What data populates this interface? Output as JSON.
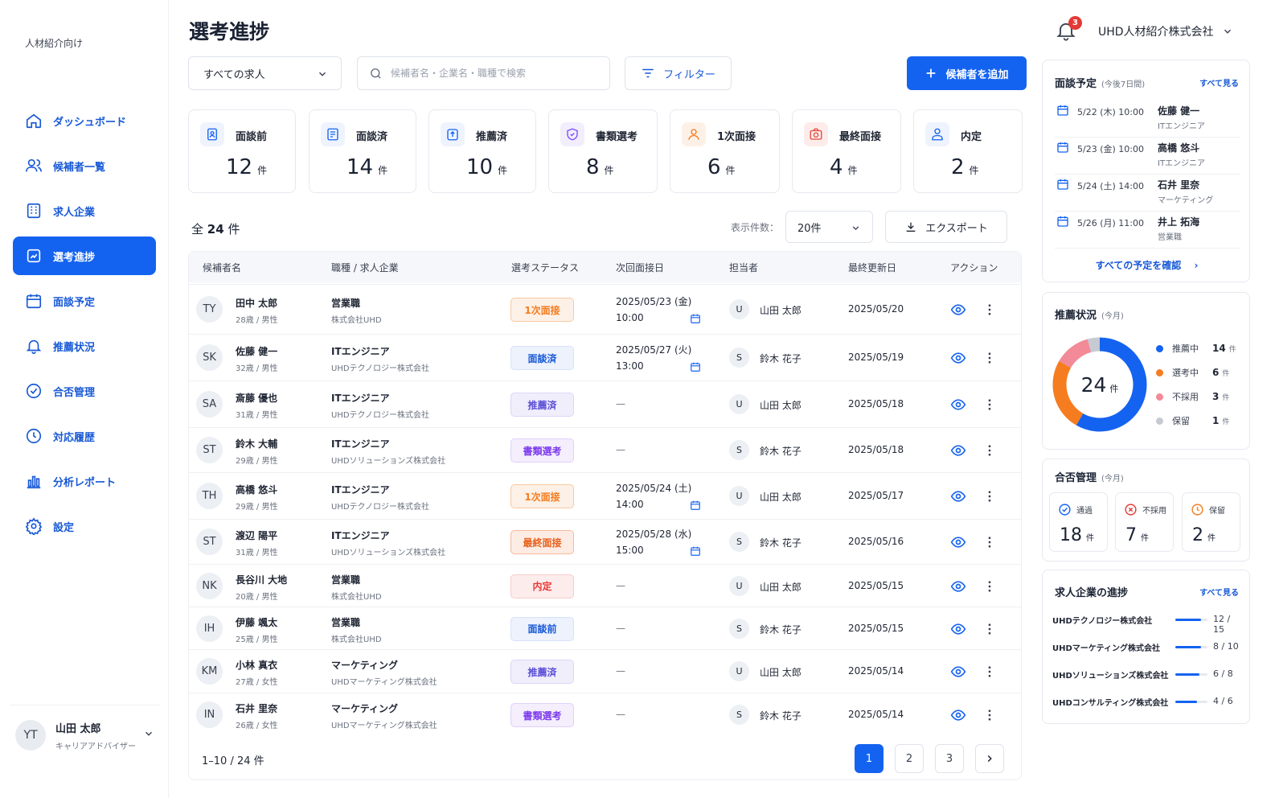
{
  "sidebar": {
    "brand": "人材紹介向け",
    "items": [
      {
        "label": "ダッシュボード",
        "icon": "home-icon"
      },
      {
        "label": "候補者一覧",
        "icon": "users-icon"
      },
      {
        "label": "求人企業",
        "icon": "building-icon"
      },
      {
        "label": "選考進捗",
        "icon": "progress-icon",
        "active": true
      },
      {
        "label": "面談予定",
        "icon": "calendar-icon"
      },
      {
        "label": "推薦状況",
        "icon": "bell-icon"
      },
      {
        "label": "合否管理",
        "icon": "check-circle-icon"
      },
      {
        "label": "対応履歴",
        "icon": "clock-icon"
      },
      {
        "label": "分析レポート",
        "icon": "bar-chart-icon"
      },
      {
        "label": "設定",
        "icon": "gear-icon"
      }
    ],
    "user": {
      "initials": "YT",
      "name": "山田 太郎",
      "role": "キャリアアドバイザー"
    }
  },
  "header": {
    "title": "選考進捗",
    "notification_count": "3",
    "company": "UHD人材紹介株式会社"
  },
  "toolbar": {
    "job_filter": "すべての求人",
    "search_placeholder": "候補者名・企業名・職種で検索",
    "filter_label": "フィルター",
    "add_label": "候補者を追加"
  },
  "stats": [
    {
      "label": "面談前",
      "value": "12",
      "unit": "件",
      "color": "#1463f0",
      "bg": "#eef3fd"
    },
    {
      "label": "面談済",
      "value": "14",
      "unit": "件",
      "color": "#1463f0",
      "bg": "#eef3fd"
    },
    {
      "label": "推薦済",
      "value": "10",
      "unit": "件",
      "color": "#1463f0",
      "bg": "#eef3fd"
    },
    {
      "label": "書類選考",
      "value": "8",
      "unit": "件",
      "color": "#7c4dff",
      "bg": "#f2eefd"
    },
    {
      "label": "1次面接",
      "value": "6",
      "unit": "件",
      "color": "#f57c1f",
      "bg": "#fdf1e7"
    },
    {
      "label": "最終面接",
      "value": "4",
      "unit": "件",
      "color": "#e5483d",
      "bg": "#fdecea"
    },
    {
      "label": "内定",
      "value": "2",
      "unit": "件",
      "color": "#1463f0",
      "bg": "#eef3fd"
    }
  ],
  "list": {
    "total_prefix": "全",
    "total": "24",
    "total_unit": "件",
    "per_page_label": "表示件数：",
    "per_page": "20件",
    "export_label": "エクスポート"
  },
  "table": {
    "columns": [
      "候補者名",
      "職種 / 求人企業",
      "選考ステータス",
      "次回面接日",
      "担当者",
      "最終更新日",
      "アクション"
    ],
    "rows": [
      {
        "initials": "TY",
        "name": "田中 太郎",
        "meta": "28歳 / 男性",
        "job": "営業職",
        "company": "株式会社UHD",
        "status": "1次面接",
        "status_type": "orange",
        "date": "2025/05/23 (金)",
        "time": "10:00",
        "staff_initial": "U",
        "staff": "山田 太郎",
        "updated": "2025/05/20"
      },
      {
        "initials": "SK",
        "name": "佐藤 健一",
        "meta": "32歳 / 男性",
        "job": "ITエンジニア",
        "company": "UHDテクノロジー株式会社",
        "status": "面談済",
        "status_type": "blue",
        "date": "2025/05/27 (火)",
        "time": "13:00",
        "staff_initial": "S",
        "staff": "鈴木 花子",
        "updated": "2025/05/19"
      },
      {
        "initials": "SA",
        "name": "斎藤 優也",
        "meta": "31歳 / 男性",
        "job": "ITエンジニア",
        "company": "UHDテクノロジー株式会社",
        "status": "推薦済",
        "status_type": "purple",
        "date": "",
        "time": "",
        "dash": "—",
        "staff_initial": "U",
        "staff": "山田 太郎",
        "updated": "2025/05/18"
      },
      {
        "initials": "ST",
        "name": "鈴木 大輔",
        "meta": "29歳 / 男性",
        "job": "ITエンジニア",
        "company": "UHDソリューションズ株式会社",
        "status": "書類選考",
        "status_type": "violet",
        "date": "",
        "time": "",
        "dash": "—",
        "staff_initial": "S",
        "staff": "鈴木 花子",
        "updated": "2025/05/18"
      },
      {
        "initials": "TH",
        "name": "高橋 悠斗",
        "meta": "29歳 / 男性",
        "job": "ITエンジニア",
        "company": "UHDテクノロジー株式会社",
        "status": "1次面接",
        "status_type": "orange",
        "date": "2025/05/24 (土)",
        "time": "14:00",
        "staff_initial": "U",
        "staff": "山田 太郎",
        "updated": "2025/05/17"
      },
      {
        "initials": "ST",
        "name": "渡辺 陽平",
        "meta": "31歳 / 男性",
        "job": "ITエンジニア",
        "company": "UHDソリューションズ株式会社",
        "status": "最終面接",
        "status_type": "orange2",
        "date": "2025/05/28 (水)",
        "time": "15:00",
        "staff_initial": "S",
        "staff": "鈴木 花子",
        "updated": "2025/05/16"
      },
      {
        "initials": "NK",
        "name": "長谷川 大地",
        "meta": "20歳 / 男性",
        "job": "営業職",
        "company": "株式会社UHD",
        "status": "内定",
        "status_type": "red",
        "date": "",
        "time": "",
        "dash": "—",
        "staff_initial": "U",
        "staff": "山田 太郎",
        "updated": "2025/05/15"
      },
      {
        "initials": "IH",
        "name": "伊藤 颯太",
        "meta": "25歳 / 男性",
        "job": "営業職",
        "company": "株式会社UHD",
        "status": "面談前",
        "status_type": "blue",
        "date": "",
        "time": "",
        "dash": "—",
        "staff_initial": "S",
        "staff": "鈴木 花子",
        "updated": "2025/05/15"
      },
      {
        "initials": "KM",
        "name": "小林 真衣",
        "meta": "27歳 / 女性",
        "job": "マーケティング",
        "company": "UHDマーケティング株式会社",
        "status": "推薦済",
        "status_type": "purple",
        "date": "",
        "time": "",
        "dash": "—",
        "staff_initial": "U",
        "staff": "山田 太郎",
        "updated": "2025/05/14"
      },
      {
        "initials": "IN",
        "name": "石井 里奈",
        "meta": "26歳 / 女性",
        "job": "マーケティング",
        "company": "UHDマーケティング株式会社",
        "status": "書類選考",
        "status_type": "violet",
        "date": "",
        "time": "",
        "dash": "—",
        "staff_initial": "S",
        "staff": "鈴木 花子",
        "updated": "2025/05/14"
      }
    ]
  },
  "pagination": {
    "info": "1–10 / 24 件",
    "pages": [
      "1",
      "2",
      "3"
    ],
    "next": "›"
  },
  "interviews": {
    "title": "面談予定",
    "subtitle": "(今後7日間)",
    "see_all": "すべて見る",
    "items": [
      {
        "when": "5/22 (木) 10:00",
        "name": "佐藤 健一",
        "position": "ITエンジニア"
      },
      {
        "when": "5/23 (金) 10:00",
        "name": "高橋 悠斗",
        "position": "ITエンジニア"
      },
      {
        "when": "5/24 (土) 14:00",
        "name": "石井 里奈",
        "position": "マーケティング"
      },
      {
        "when": "5/26 (月) 11:00",
        "name": "井上 拓海",
        "position": "営業職"
      }
    ],
    "confirm_label": "すべての予定を確認"
  },
  "recommend": {
    "title": "推薦状況",
    "subtitle": "(今月)",
    "total": "24",
    "total_unit": "件",
    "legend": [
      {
        "label": "推薦中",
        "value": 14,
        "unit": "件",
        "color": "#1463f0"
      },
      {
        "label": "選考中",
        "value": 6,
        "unit": "件",
        "color": "#f57c1f"
      },
      {
        "label": "不採用",
        "value": 3,
        "unit": "件",
        "color": "#f28b97"
      },
      {
        "label": "保留",
        "value": 1,
        "unit": "件",
        "color": "#c5cad3"
      }
    ]
  },
  "passfail": {
    "title": "合否管理",
    "subtitle": "(今月)",
    "items": [
      {
        "label": "通過",
        "value": "18",
        "unit": "件",
        "color": "#1463f0",
        "icon": "check-circle-icon"
      },
      {
        "label": "不採用",
        "value": "7",
        "unit": "件",
        "color": "#e53935",
        "icon": "x-circle-icon"
      },
      {
        "label": "保留",
        "value": "2",
        "unit": "件",
        "color": "#f57c1f",
        "icon": "clock-icon"
      }
    ]
  },
  "company_progress": {
    "title": "求人企業の進捗",
    "see_all": "すべて見る",
    "items": [
      {
        "name": "UHDテクノロジー株式会社",
        "done": 12,
        "total": 15,
        "label": "12 / 15"
      },
      {
        "name": "UHDマーケティング株式会社",
        "done": 8,
        "total": 10,
        "label": "8 / 10"
      },
      {
        "name": "UHDソリューションズ株式会社",
        "done": 6,
        "total": 8,
        "label": "6 / 8"
      },
      {
        "name": "UHDコンサルティング株式会社",
        "done": 4,
        "total": 6,
        "label": "4 / 6"
      }
    ]
  }
}
